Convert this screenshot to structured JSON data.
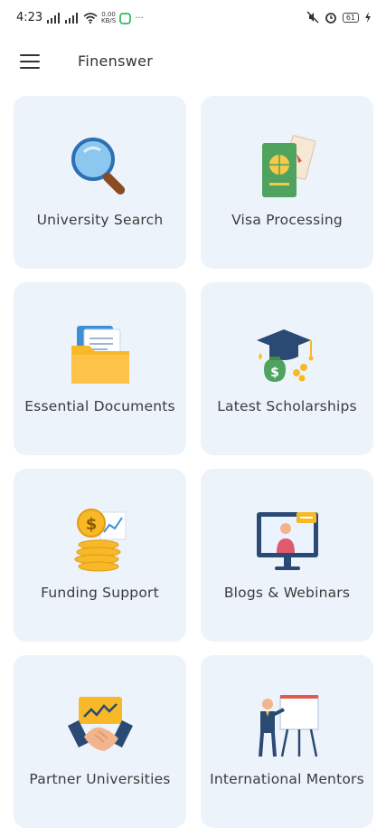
{
  "status_bar": {
    "time": "4:23",
    "net_speed_value": "0.00",
    "net_speed_unit": "KB/S",
    "battery": "61"
  },
  "header": {
    "title": "Finenswer"
  },
  "tiles": [
    {
      "label": "University Search",
      "icon": "magnifier-icon"
    },
    {
      "label": "Visa Processing",
      "icon": "passport-icon"
    },
    {
      "label": "Essential Documents",
      "icon": "folder-icon"
    },
    {
      "label": "Latest Scholarships",
      "icon": "graduation-money-icon"
    },
    {
      "label": "Funding Support",
      "icon": "coins-icon"
    },
    {
      "label": "Blogs & Webinars",
      "icon": "monitor-presenter-icon"
    },
    {
      "label": "Partner Universities",
      "icon": "handshake-icon"
    },
    {
      "label": "International Mentors",
      "icon": "mentor-board-icon"
    }
  ],
  "colors": {
    "tile_bg": "#edf3fb",
    "accent_yellow": "#f7b928",
    "accent_blue": "#2d6fb3"
  }
}
